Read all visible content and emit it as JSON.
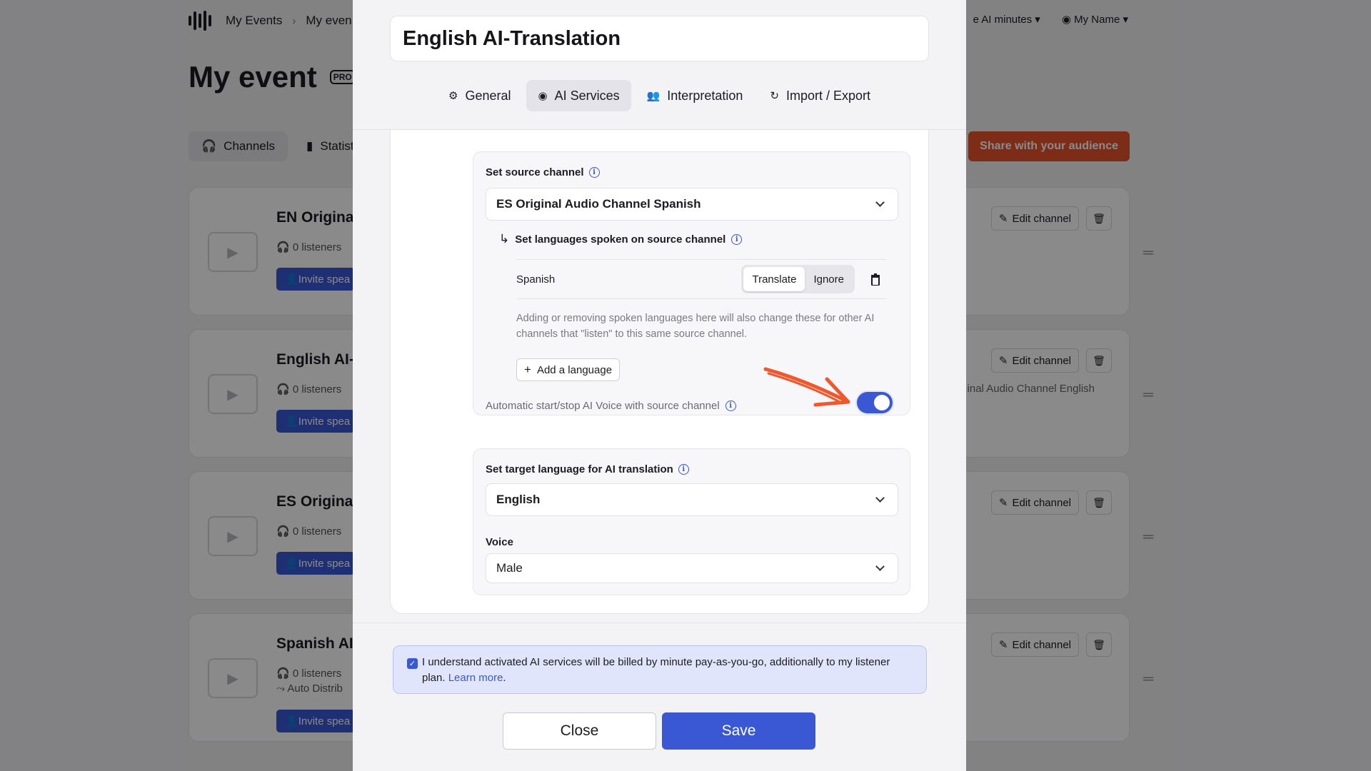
{
  "background": {
    "breadcrumb": [
      "My Events",
      "My even"
    ],
    "header_right": [
      "e AI minutes",
      "My Name"
    ],
    "page_title": "My event",
    "pro_badge": "PRO",
    "tabs": [
      "Channels",
      "Statist"
    ],
    "share_button": "Share with your audience",
    "cards": [
      {
        "title": "EN Original",
        "listeners": "0 listeners",
        "invite": "Invite spea",
        "edit": "Edit channel",
        "note": "",
        "autodist": ""
      },
      {
        "title": "English AI-T",
        "listeners": "0 listeners",
        "invite": "Invite spea",
        "edit": "Edit channel",
        "note": "inal Audio Channel English",
        "autodist": ""
      },
      {
        "title": "ES Original",
        "listeners": "0 listeners",
        "invite": "Invite spea",
        "edit": "Edit channel",
        "note": "",
        "autodist": ""
      },
      {
        "title": "Spanish AI-",
        "listeners": "0 listeners",
        "invite": "Invite spea",
        "edit": "Edit channel",
        "note": "",
        "autodist": "Auto Distrib"
      }
    ]
  },
  "modal": {
    "title": "English AI-Translation",
    "tabs": [
      {
        "label": "General",
        "icon": "gear-icon"
      },
      {
        "label": "AI Services",
        "icon": "ai-icon"
      },
      {
        "label": "Interpretation",
        "icon": "interpreters-icon"
      },
      {
        "label": "Import / Export",
        "icon": "sync-icon"
      }
    ],
    "active_tab": "AI Services",
    "source": {
      "label": "Set source channel",
      "value": "ES Original Audio Channel Spanish",
      "languages_label": "Set languages spoken on source channel",
      "languages": [
        {
          "name": "Spanish",
          "options": [
            "Translate",
            "Ignore"
          ],
          "selected": "Translate"
        }
      ],
      "help_text": "Adding or removing spoken languages here will also change these for other AI channels that \"listen\" to this same source channel.",
      "add_language": "Add a language",
      "auto_label": "Automatic start/stop AI Voice with source channel",
      "auto_enabled": true
    },
    "target": {
      "label": "Set target language for AI translation",
      "value": "English",
      "voice_label": "Voice",
      "voice_value": "Male"
    },
    "consent": {
      "checked": true,
      "text": "I understand activated AI services will be billed by minute pay-as-you-go, additionally to my listener plan.",
      "link": "Learn more",
      "suffix": "."
    },
    "close_button": "Close",
    "save_button": "Save"
  },
  "colors": {
    "accent": "#3a57d4",
    "share": "#e8532c",
    "annotation_arrow": "#f0572d"
  }
}
